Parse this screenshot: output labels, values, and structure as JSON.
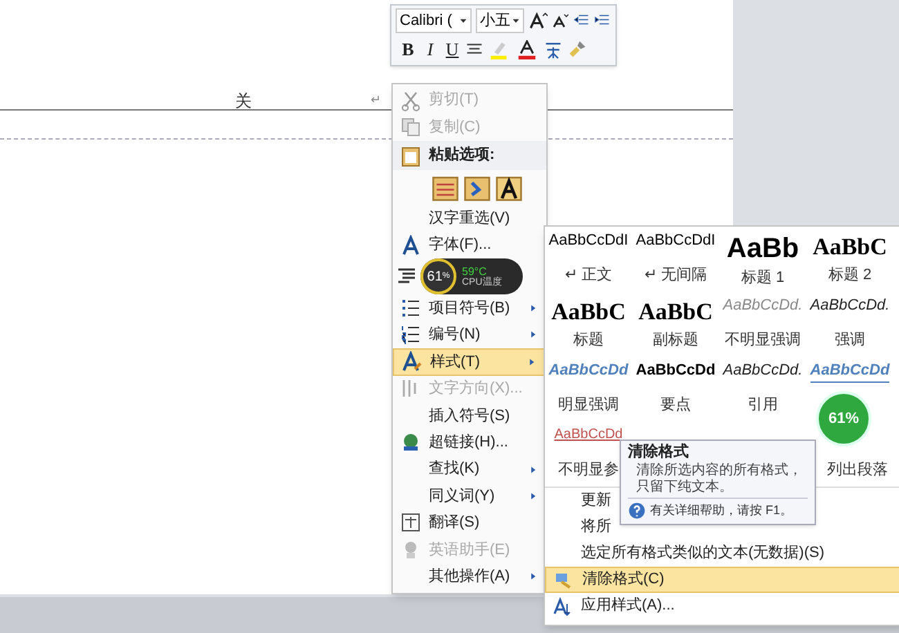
{
  "document": {
    "heading": "关",
    "mark": "↵"
  },
  "mini_toolbar": {
    "font": "Calibri (",
    "size": "小五",
    "format_buttons": [
      "B",
      "I",
      "U"
    ]
  },
  "context_menu": [
    {
      "kind": "item",
      "label": "剪切(T)",
      "disabled": true,
      "selected": false,
      "submenu": false
    },
    {
      "kind": "item",
      "label": "复制(C)",
      "disabled": true,
      "selected": false,
      "submenu": false
    },
    {
      "kind": "header",
      "label": "粘贴选项:"
    },
    {
      "kind": "paste"
    },
    {
      "kind": "item",
      "label": "汉字重选(V)",
      "disabled": false,
      "selected": false,
      "submenu": false
    },
    {
      "kind": "item",
      "label": "字体(F)...",
      "disabled": false,
      "selected": false,
      "submenu": false
    },
    {
      "kind": "covered"
    },
    {
      "kind": "item",
      "label": "项目符号(B)",
      "disabled": false,
      "selected": false,
      "submenu": true
    },
    {
      "kind": "item",
      "label": "编号(N)",
      "disabled": false,
      "selected": false,
      "submenu": true
    },
    {
      "kind": "item",
      "label": "样式(T)",
      "disabled": false,
      "selected": true,
      "submenu": true
    },
    {
      "kind": "item",
      "label": "文字方向(X)...",
      "disabled": true,
      "selected": false,
      "submenu": false
    },
    {
      "kind": "item",
      "label": "插入符号(S)",
      "disabled": false,
      "selected": false,
      "submenu": false
    },
    {
      "kind": "item",
      "label": "超链接(H)...",
      "disabled": false,
      "selected": false,
      "submenu": false
    },
    {
      "kind": "item",
      "label": "查找(K)",
      "disabled": false,
      "selected": false,
      "submenu": true
    },
    {
      "kind": "item",
      "label": "同义词(Y)",
      "disabled": false,
      "selected": false,
      "submenu": true
    },
    {
      "kind": "item",
      "label": "翻译(S)",
      "disabled": false,
      "selected": false,
      "submenu": false
    },
    {
      "kind": "item",
      "label": "英语助手(E)",
      "disabled": true,
      "selected": false,
      "submenu": false
    },
    {
      "kind": "item",
      "label": "其他操作(A)",
      "disabled": false,
      "selected": false,
      "submenu": true
    }
  ],
  "styles_gallery": [
    {
      "kind": "normal",
      "sample": "AaBbCcDdI",
      "caption": "↵ 正文"
    },
    {
      "kind": "normal",
      "sample": "AaBbCcDdI",
      "caption": "↵ 无间隔"
    },
    {
      "kind": "heading1",
      "sample": "AaBb",
      "caption": "标题 1"
    },
    {
      "kind": "heading2",
      "sample": "AaBbC",
      "caption": "标题 2"
    },
    {
      "kind": "title",
      "sample": "AaBbC",
      "caption": "标题"
    },
    {
      "kind": "title",
      "sample": "AaBbC",
      "caption": "副标题"
    },
    {
      "kind": "subtle_emphasis",
      "sample": "AaBbCcDd.",
      "caption": "不明显强调"
    },
    {
      "kind": "emphasis",
      "sample": "AaBbCcDd.",
      "caption": "强调"
    },
    {
      "kind": "intense_emphasis",
      "sample": "AaBbCcDd",
      "caption": "明显强调"
    },
    {
      "kind": "strong",
      "sample": "AaBbCcDd",
      "caption": "要点"
    },
    {
      "kind": "emphasis",
      "sample": "AaBbCcDd.",
      "caption": "引用"
    },
    {
      "kind": "intense_quote",
      "sample": "AaBbCcDd"
    },
    {
      "kind": "subtle_reference",
      "sample": "AaBbCcDd",
      "caption": "不明显参"
    },
    {
      "kind": "hidden"
    },
    {
      "kind": "hidden"
    },
    {
      "kind": "caption_only",
      "caption": "列出段落"
    }
  ],
  "styles_menu": [
    {
      "label": "更新",
      "selected": false
    },
    {
      "label": "将所",
      "selected": false
    },
    {
      "label": "选定所有格式类似的文本(无数据)(S)",
      "selected": false
    },
    {
      "label": "清除格式(C)",
      "selected": true
    },
    {
      "label": "应用样式(A)...",
      "selected": false
    }
  ],
  "tooltip": {
    "title": "清除格式",
    "body": "清除所选内容的所有格式，只留下纯文本。",
    "help": "有关详细帮助，请按 F1。"
  },
  "cpu_widget": {
    "percent": "61",
    "unit": "%",
    "temp": "59°C",
    "label": "CPU温度"
  },
  "cpu_ball": {
    "text": "61%"
  }
}
